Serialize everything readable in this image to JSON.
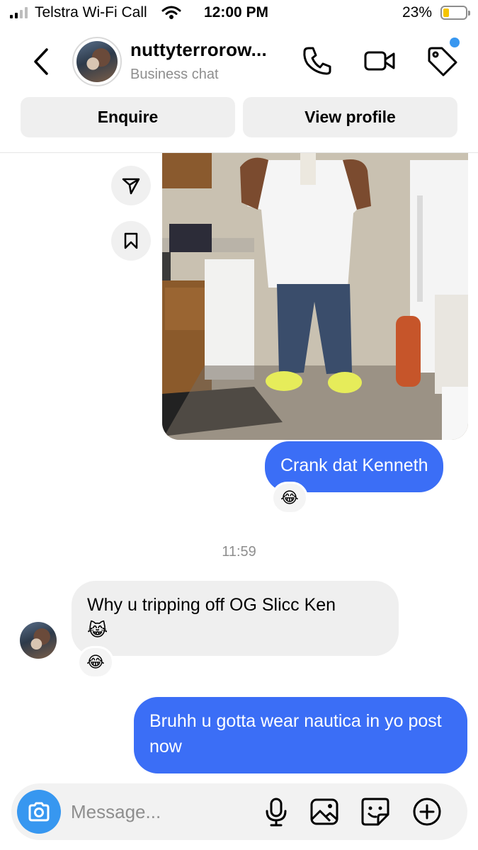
{
  "status_bar": {
    "carrier": "Telstra Wi-Fi Call",
    "time": "12:00 PM",
    "battery": "23%",
    "battery_level": 0.23
  },
  "header": {
    "username": "nuttyterrorow...",
    "subtitle": "Business chat",
    "icons": [
      "back-arrow-icon",
      "phone-icon",
      "video-icon",
      "tag-icon"
    ]
  },
  "actions": {
    "enquire": "Enquire",
    "view_profile": "View profile"
  },
  "messages": [
    {
      "from": "me",
      "text": "Crank dat Kenneth",
      "reaction": "😂"
    },
    {
      "from": "them",
      "text": "Why u tripping off OG Slicc Ken",
      "emoji": "😹",
      "reaction": "😂"
    },
    {
      "from": "me",
      "text": "Bruhh u gotta wear nautica in yo post now"
    }
  ],
  "timestamp": "11:59",
  "composer": {
    "placeholder": "Message...",
    "icons": [
      "camera-icon",
      "microphone-icon",
      "gallery-icon",
      "sticker-icon",
      "plus-icon"
    ]
  },
  "colors": {
    "accent": "#3b6ef6",
    "camera": "#3797f0",
    "bubble_in": "#efefef"
  }
}
